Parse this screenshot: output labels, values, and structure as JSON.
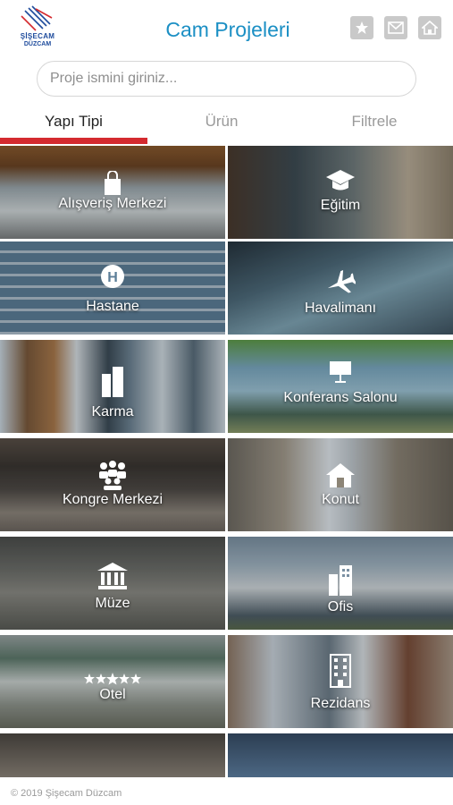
{
  "header": {
    "logo_brand": "ŞİŞECAM",
    "logo_sub": "DÜZCAM",
    "title": "Cam Projeleri",
    "favorites_icon": "star-icon",
    "mail_icon": "mail-icon",
    "home_icon": "home-icon"
  },
  "search": {
    "placeholder": "Proje ismini giriniz..."
  },
  "tabs": [
    {
      "label": "Yapı Tipi",
      "active": true
    },
    {
      "label": "Ürün",
      "active": false
    },
    {
      "label": "Filtrele",
      "active": false
    }
  ],
  "categories": [
    {
      "label": "Alışveriş Merkezi",
      "icon": "shopping-bag-icon"
    },
    {
      "label": "Eğitim",
      "icon": "graduation-cap-icon"
    },
    {
      "label": "Hastane",
      "icon": "hospital-icon"
    },
    {
      "label": "Havalimanı",
      "icon": "airplane-icon"
    },
    {
      "label": "Karma",
      "icon": "buildings-icon"
    },
    {
      "label": "Konferans Salonu",
      "icon": "presentation-icon"
    },
    {
      "label": "Kongre Merkezi",
      "icon": "people-group-icon"
    },
    {
      "label": "Konut",
      "icon": "house-icon"
    },
    {
      "label": "Müze",
      "icon": "museum-icon"
    },
    {
      "label": "Ofis",
      "icon": "office-building-icon"
    },
    {
      "label": "Otel",
      "icon": "stars-icon"
    },
    {
      "label": "Rezidans",
      "icon": "residence-icon"
    }
  ],
  "footer": {
    "copyright": "© 2019 Şişecam Düzcam"
  },
  "colors": {
    "title_blue": "#1b8fc4",
    "tab_indicator_red": "#d42a2f",
    "icon_button_gray": "#c9c9c9",
    "logo_blue": "#1e4b9c"
  }
}
